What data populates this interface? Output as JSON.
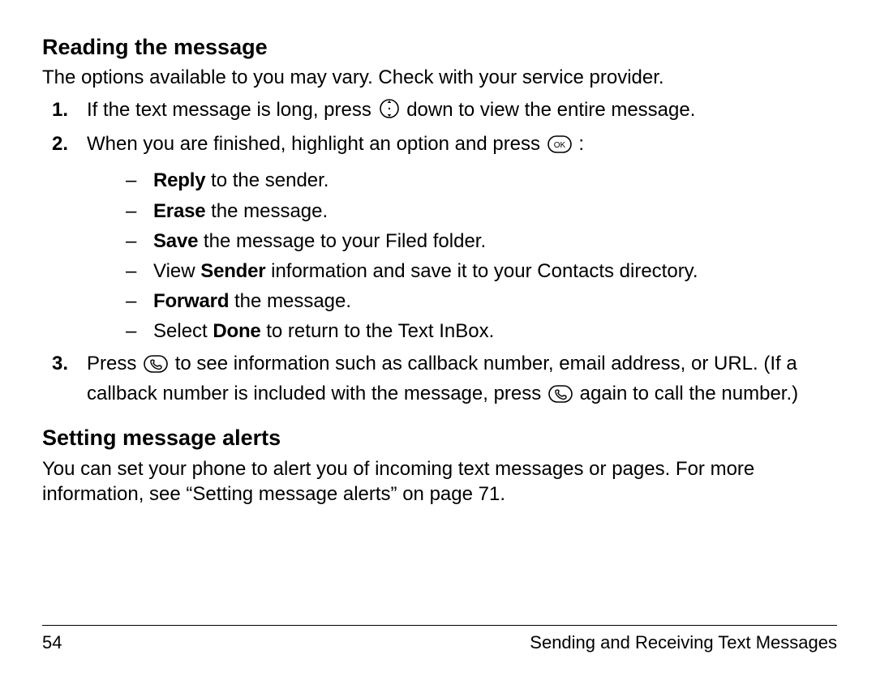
{
  "section1": {
    "heading": "Reading the message",
    "intro": "The options available to you may vary. Check with your service provider.",
    "step1_pre": "If the text message is long, press ",
    "step1_post": " down to view the entire message.",
    "step2_pre": "When you are finished, highlight an option and press ",
    "step2_post": " :",
    "options": {
      "reply": {
        "bold": "Reply",
        "rest": " to the sender."
      },
      "erase": {
        "bold": "Erase",
        "rest": " the message."
      },
      "save": {
        "bold": "Save",
        "rest": " the message to your Filed folder."
      },
      "sender": {
        "pre": "View ",
        "bold": "Sender",
        "rest": " information and save it to your Contacts directory."
      },
      "forward": {
        "bold": "Forward",
        "rest": " the message."
      },
      "done": {
        "pre": "Select ",
        "bold": "Done",
        "rest": " to return to the Text InBox."
      }
    },
    "step3_a": "Press ",
    "step3_b": " to see information such as callback number, email address, or URL. (If a callback number is included with the message, press ",
    "step3_c": " again to call the number.)"
  },
  "section2": {
    "heading": "Setting message alerts",
    "body": "You can set your phone to alert you of incoming text messages or pages. For more information, see “Setting message alerts” on page 71."
  },
  "footer": {
    "page_number": "54",
    "chapter": "Sending and Receiving Text Messages"
  },
  "icons": {
    "nav": "navigation-key-icon",
    "ok": "ok-key-icon",
    "phone": "phone-key-icon"
  }
}
